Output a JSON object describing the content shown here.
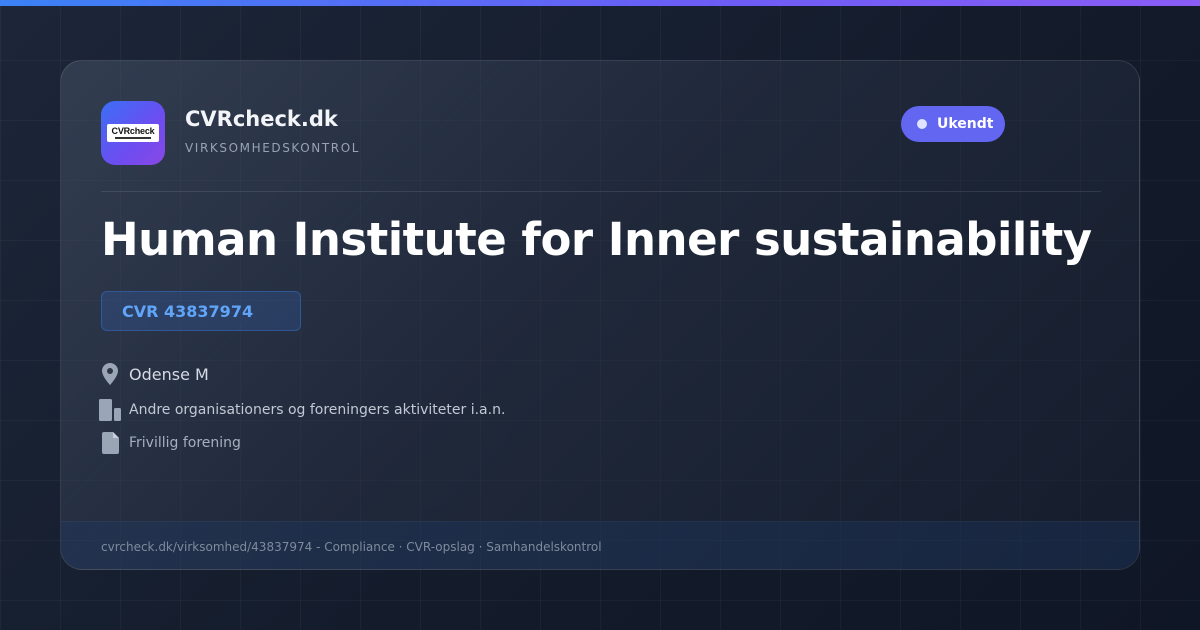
{
  "brand": {
    "logo_text": "CVRcheck",
    "name": "CVRcheck.dk",
    "tagline": "VIRKSOMHEDSKONTROL",
    "accent": "#6366f1"
  },
  "status": {
    "label": "Ukendt",
    "color": "#6366f1"
  },
  "company": {
    "name": "Human Institute for Inner sustainability",
    "cvr": "CVR 43837974",
    "location": "Odense M",
    "industry": "Andre organisationers og foreningers aktiviteter i.a.n.",
    "legal_form": "Frivillig forening"
  },
  "icons": {
    "location": "map-pin-icon",
    "industry": "building-icon",
    "legal_form": "document-icon"
  },
  "footer": {
    "text": "cvrcheck.dk/virksomhed/43837974 - Compliance · CVR-opslag · Samhandelskontrol"
  }
}
